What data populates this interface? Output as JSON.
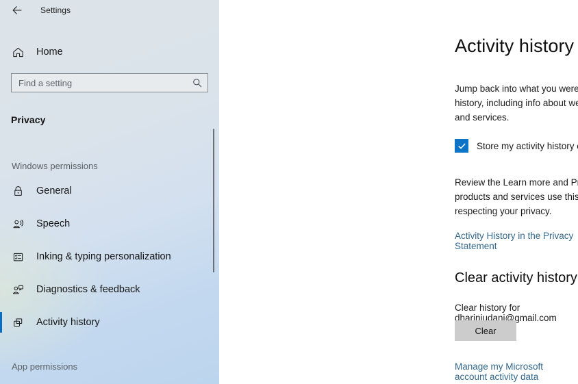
{
  "window": {
    "back_icon": "back-arrow-icon",
    "title": "Settings"
  },
  "sidebar": {
    "home": {
      "label": "Home",
      "icon": "home-icon"
    },
    "search": {
      "placeholder": "Find a setting",
      "value": "",
      "icon": "search-icon"
    },
    "category": "Privacy",
    "groups": [
      {
        "label": "Windows permissions",
        "items": [
          {
            "label": "General",
            "icon": "lock-icon",
            "active": false
          },
          {
            "label": "Speech",
            "icon": "speech-person-icon",
            "active": false
          },
          {
            "label": "Inking & typing personalization",
            "icon": "form-list-icon",
            "active": false
          },
          {
            "label": "Diagnostics & feedback",
            "icon": "person-feedback-icon",
            "active": false
          },
          {
            "label": "Activity history",
            "icon": "overlapping-windows-icon",
            "active": true
          }
        ]
      },
      {
        "label": "App permissions",
        "items": []
      }
    ],
    "accent_color": "#0a6cc4",
    "scrollbar": {
      "name": "sidebar-scrollbar"
    }
  },
  "main": {
    "page_title": "Activity history",
    "intro_paragraph": "Jump back into what you were doing on your device by storing your activity history, including info about websites you browse and how you use apps and services.",
    "checkbox": {
      "label": "Store my activity history on this device",
      "checked": true,
      "color": "#0d74c8"
    },
    "review_paragraph": "Review the Learn more and Privacy Statement to find out how Microsoft products and services use this data to personalize experiences while respecting your privacy.",
    "privacy_link": "Activity History in the Privacy Statement",
    "clear_section": {
      "heading": "Clear activity history",
      "description": "Clear history for dhariniudani@gmail.com",
      "button_label": "Clear"
    },
    "manage_link": "Manage my Microsoft account activity data",
    "link_color": "#33688c"
  }
}
